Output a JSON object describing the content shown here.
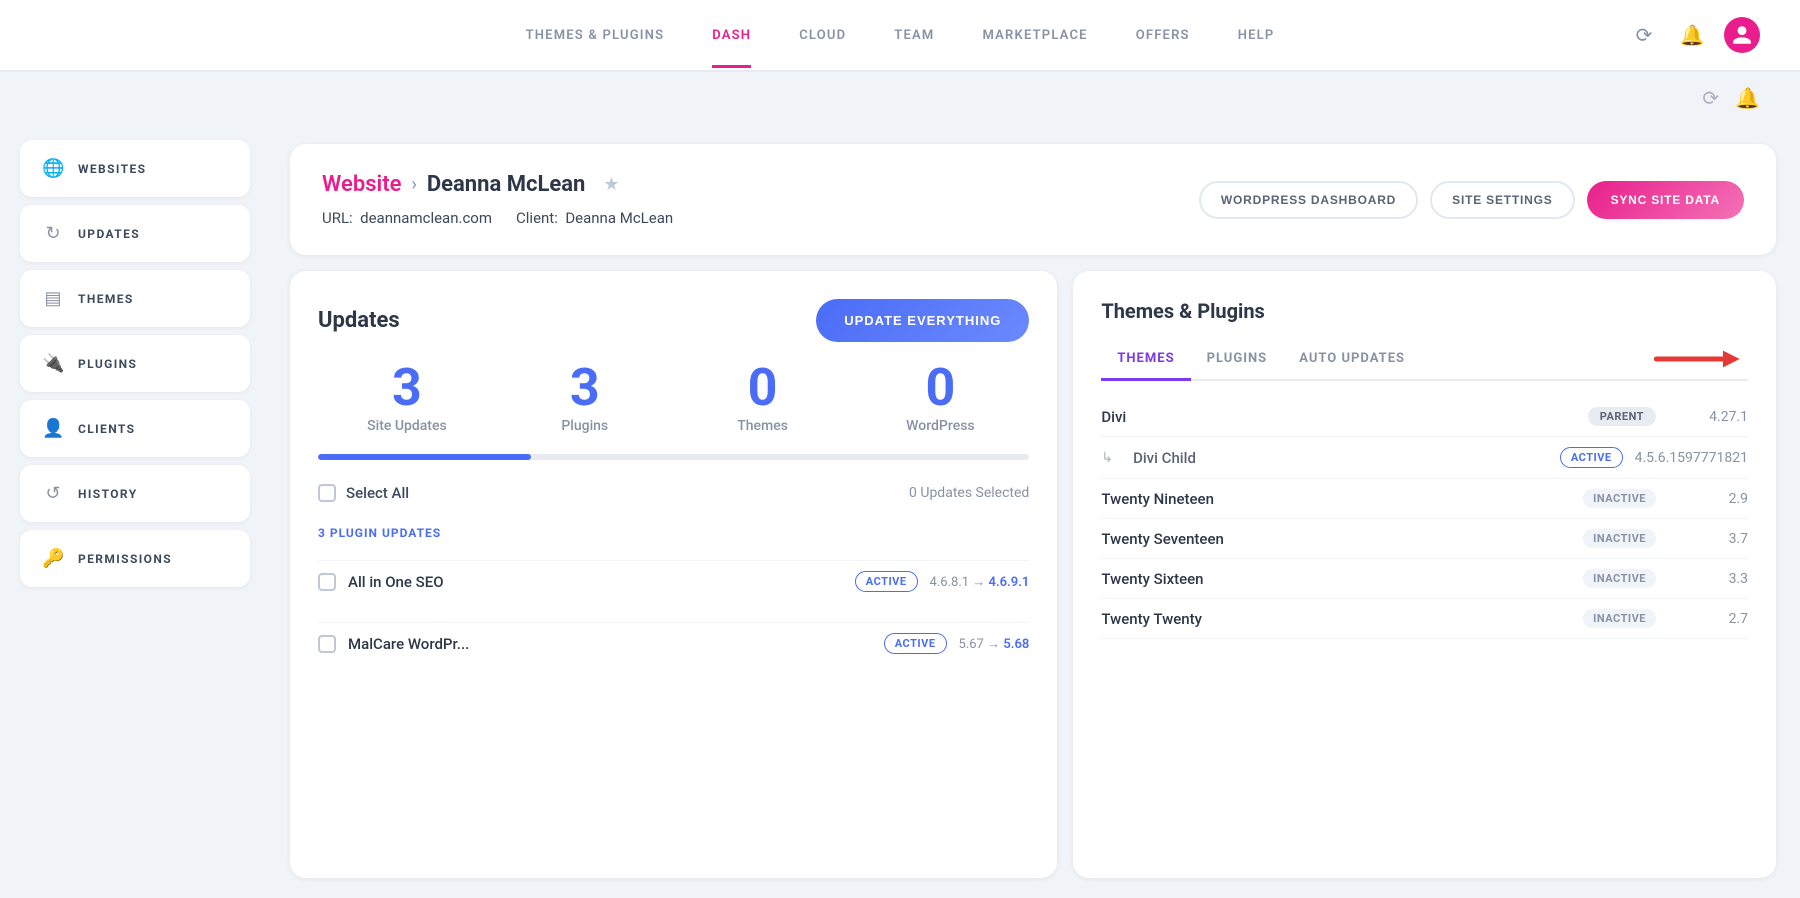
{
  "nav": {
    "links": [
      {
        "id": "themes-plugins",
        "label": "THEMES & PLUGINS",
        "active": false
      },
      {
        "id": "dash",
        "label": "DASH",
        "active": true
      },
      {
        "id": "cloud",
        "label": "CLOUD",
        "active": false
      },
      {
        "id": "team",
        "label": "TEAM",
        "active": false
      },
      {
        "id": "marketplace",
        "label": "MARKETPLACE",
        "active": false
      },
      {
        "id": "offers",
        "label": "OFFERS",
        "active": false
      },
      {
        "id": "help",
        "label": "HELP",
        "active": false
      }
    ]
  },
  "sidebar": {
    "items": [
      {
        "id": "websites",
        "label": "WEBSITES",
        "icon": "🌐",
        "active": false,
        "pink": true
      },
      {
        "id": "updates",
        "label": "UPDATES",
        "icon": "↻",
        "active": false
      },
      {
        "id": "themes",
        "label": "THEMES",
        "icon": "▤",
        "active": false
      },
      {
        "id": "plugins",
        "label": "PLUGINS",
        "icon": "🔌",
        "active": false
      },
      {
        "id": "clients",
        "label": "CLIENTS",
        "icon": "👤",
        "active": false
      },
      {
        "id": "history",
        "label": "HISTORY",
        "icon": "↺",
        "active": false
      },
      {
        "id": "permissions",
        "label": "PERMISSIONS",
        "icon": "🔑",
        "active": false
      }
    ]
  },
  "site_header": {
    "breadcrumb_website": "Website",
    "breadcrumb_arrow": "›",
    "site_name": "Deanna McLean",
    "url_label": "URL:",
    "url_value": "deannamclean.com",
    "client_label": "Client:",
    "client_value": "Deanna McLean",
    "btn_wordpress": "WORDPRESS DASHBOARD",
    "btn_settings": "SITE SETTINGS",
    "btn_sync": "SYNC SITE DATA"
  },
  "updates": {
    "title": "Updates",
    "btn_update": "UPDATE EVERYTHING",
    "stats": [
      {
        "number": "3",
        "label": "Site Updates"
      },
      {
        "number": "3",
        "label": "Plugins"
      },
      {
        "number": "0",
        "label": "Themes"
      },
      {
        "number": "0",
        "label": "WordPress"
      }
    ],
    "progress_pct": 30,
    "select_all_label": "Select All",
    "updates_count": "0 Updates Selected",
    "section_label": "3 PLUGIN UPDATES",
    "plugins": [
      {
        "name": "All in One SEO",
        "badge": "ACTIVE",
        "version_from": "4.6.8.1",
        "arrow": "→",
        "version_to": "4.6.9.1"
      },
      {
        "name": "MalCare WordPr...",
        "badge": "ACTIVE",
        "version_from": "5.67",
        "arrow": "→",
        "version_to": "5.68"
      }
    ]
  },
  "themes_plugins": {
    "title": "Themes & Plugins",
    "tabs": [
      {
        "id": "themes",
        "label": "THEMES",
        "active": true
      },
      {
        "id": "plugins",
        "label": "PLUGINS",
        "active": false
      },
      {
        "id": "auto-updates",
        "label": "AUTO UPDATES",
        "active": false
      }
    ],
    "themes": [
      {
        "name": "Divi",
        "child": false,
        "badge_type": "parent",
        "badge_label": "PARENT",
        "version": "4.27.1"
      },
      {
        "name": "Divi Child",
        "child": true,
        "badge_type": "active",
        "badge_label": "ACTIVE",
        "version": "4.5.6.1597771821"
      },
      {
        "name": "Twenty Nineteen",
        "child": false,
        "badge_type": "inactive",
        "badge_label": "INACTIVE",
        "version": "2.9"
      },
      {
        "name": "Twenty Seventeen",
        "child": false,
        "badge_type": "inactive",
        "badge_label": "INACTIVE",
        "version": "3.7"
      },
      {
        "name": "Twenty Sixteen",
        "child": false,
        "badge_type": "inactive",
        "badge_label": "INACTIVE",
        "version": "3.3"
      },
      {
        "name": "Twenty Twenty",
        "child": false,
        "badge_type": "inactive",
        "badge_label": "INACTIVE",
        "version": "2.7"
      }
    ]
  }
}
